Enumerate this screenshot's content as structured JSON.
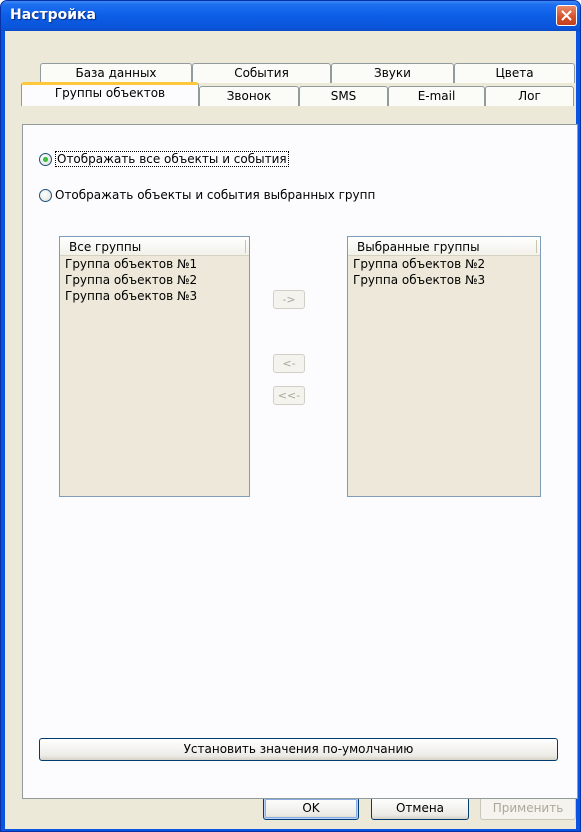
{
  "window": {
    "title": "Настройка"
  },
  "tabs_back": [
    "База данных",
    "События",
    "Звуки",
    "Цвета"
  ],
  "tabs_front": [
    "Группы объектов",
    "Звонок",
    "SMS",
    "E-mail",
    "Лог"
  ],
  "radio": {
    "all": "Отображать все объекты и события",
    "selected": "Отображать объекты и события выбранных групп",
    "checked": "all"
  },
  "all_groups": {
    "header": "Все группы",
    "items": [
      "Группа объектов №1",
      "Группа объектов №2",
      "Группа объектов №3"
    ]
  },
  "selected_groups": {
    "header": "Выбранные группы",
    "items": [
      "Группа объектов №2",
      "Группа объектов №3"
    ]
  },
  "transfer": {
    "add": "->",
    "remove": "<-",
    "remove_all": "<<-"
  },
  "buttons": {
    "defaults": "Установить значения по-умолчанию",
    "ok": "OK",
    "cancel": "Отмена",
    "apply": "Применить"
  },
  "colors": {
    "title_bar": "#0c5ee6",
    "dialog_bg": "#ece9d8",
    "list_bg": "#ede8d9",
    "active_tab_accent": "#ffc83c"
  }
}
